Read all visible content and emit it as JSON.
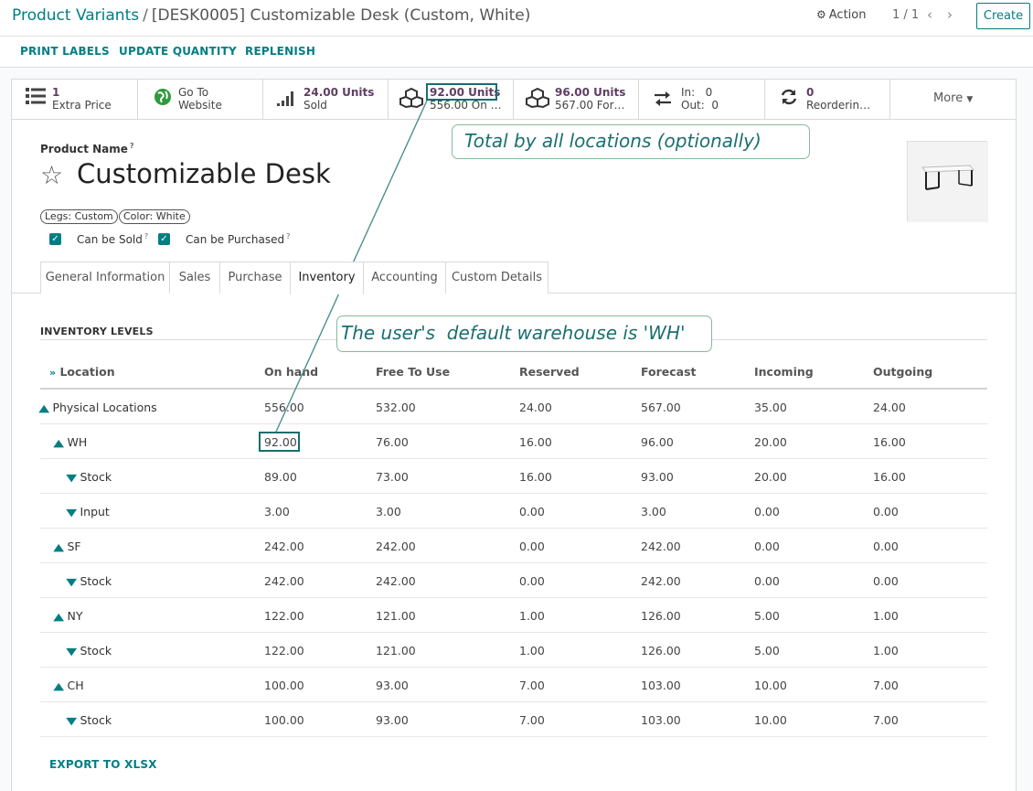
{
  "breadcrumb": {
    "parent": "Product Variants",
    "separator": "/",
    "current": "[DESK0005] Customizable Desk (Custom, White)"
  },
  "header": {
    "action_label": "Action",
    "pager_value": "1 / 1",
    "create_label": "Create"
  },
  "statusbar": {
    "print_labels": "PRINT LABELS",
    "update_quantity": "UPDATE QUANTITY",
    "replenish": "REPLENISH"
  },
  "smart_buttons": [
    {
      "icon": "list-icon",
      "top": "1",
      "bottom": "Extra Price"
    },
    {
      "icon": "globe-icon",
      "top": "Go To",
      "bottom": "Website"
    },
    {
      "icon": "bar-chart-icon",
      "top": "24.00 Units",
      "bottom": "Sold"
    },
    {
      "icon": "cubes-icon",
      "top": "92.00 Units",
      "bottom": "556.00 On …"
    },
    {
      "icon": "cubes-icon",
      "top": "96.00 Units",
      "bottom": "567.00 For…"
    },
    {
      "icon": "exchange-icon",
      "top": "In:   0",
      "bottom": "Out:  0"
    },
    {
      "icon": "refresh-icon",
      "top": "0",
      "bottom": "Reorderin…"
    }
  ],
  "more_label": "More",
  "callouts": {
    "total": "Total by all locations (optionally)",
    "warehouse": "The user's  default warehouse is 'WH'"
  },
  "product": {
    "name_label": "Product Name",
    "help_mark": "?",
    "name": "Customizable Desk",
    "tags": [
      "Legs: Custom",
      "Color: White"
    ],
    "can_be_sold": "Can be Sold",
    "can_be_purchased": "Can be Purchased"
  },
  "tabs": [
    "General Information",
    "Sales",
    "Purchase",
    "Inventory",
    "Accounting",
    "Custom Details"
  ],
  "inventory": {
    "title": "INVENTORY LEVELS",
    "columns": [
      "Location",
      "On hand",
      "Free To Use",
      "Reserved",
      "Forecast",
      "Incoming",
      "Outgoing"
    ],
    "rows": [
      {
        "level": 0,
        "expanded": true,
        "location": "Physical Locations",
        "values": [
          "556.00",
          "532.00",
          "24.00",
          "567.00",
          "35.00",
          "24.00"
        ]
      },
      {
        "level": 1,
        "expanded": true,
        "location": "WH",
        "values": [
          "92.00",
          "76.00",
          "16.00",
          "96.00",
          "20.00",
          "16.00"
        ]
      },
      {
        "level": 2,
        "expanded": false,
        "location": "Stock",
        "values": [
          "89.00",
          "73.00",
          "16.00",
          "93.00",
          "20.00",
          "16.00"
        ]
      },
      {
        "level": 2,
        "expanded": false,
        "location": "Input",
        "values": [
          "3.00",
          "3.00",
          "0.00",
          "3.00",
          "0.00",
          "0.00"
        ]
      },
      {
        "level": 1,
        "expanded": true,
        "location": "SF",
        "values": [
          "242.00",
          "242.00",
          "0.00",
          "242.00",
          "0.00",
          "0.00"
        ]
      },
      {
        "level": 2,
        "expanded": false,
        "location": "Stock",
        "values": [
          "242.00",
          "242.00",
          "0.00",
          "242.00",
          "0.00",
          "0.00"
        ]
      },
      {
        "level": 1,
        "expanded": true,
        "location": "NY",
        "values": [
          "122.00",
          "121.00",
          "1.00",
          "126.00",
          "5.00",
          "1.00"
        ]
      },
      {
        "level": 2,
        "expanded": false,
        "location": "Stock",
        "values": [
          "122.00",
          "121.00",
          "1.00",
          "126.00",
          "5.00",
          "1.00"
        ]
      },
      {
        "level": 1,
        "expanded": true,
        "location": "CH",
        "values": [
          "100.00",
          "93.00",
          "7.00",
          "103.00",
          "10.00",
          "7.00"
        ]
      },
      {
        "level": 2,
        "expanded": false,
        "location": "Stock",
        "values": [
          "100.00",
          "93.00",
          "7.00",
          "103.00",
          "10.00",
          "7.00"
        ]
      }
    ],
    "export_label": "EXPORT TO XLSX"
  },
  "colors": {
    "accent": "#017e84",
    "smart_value": "#5f3d63",
    "callout_text": "#1b6f70",
    "callout_border": "#86b99b",
    "highlight": "#1a6d6f"
  }
}
